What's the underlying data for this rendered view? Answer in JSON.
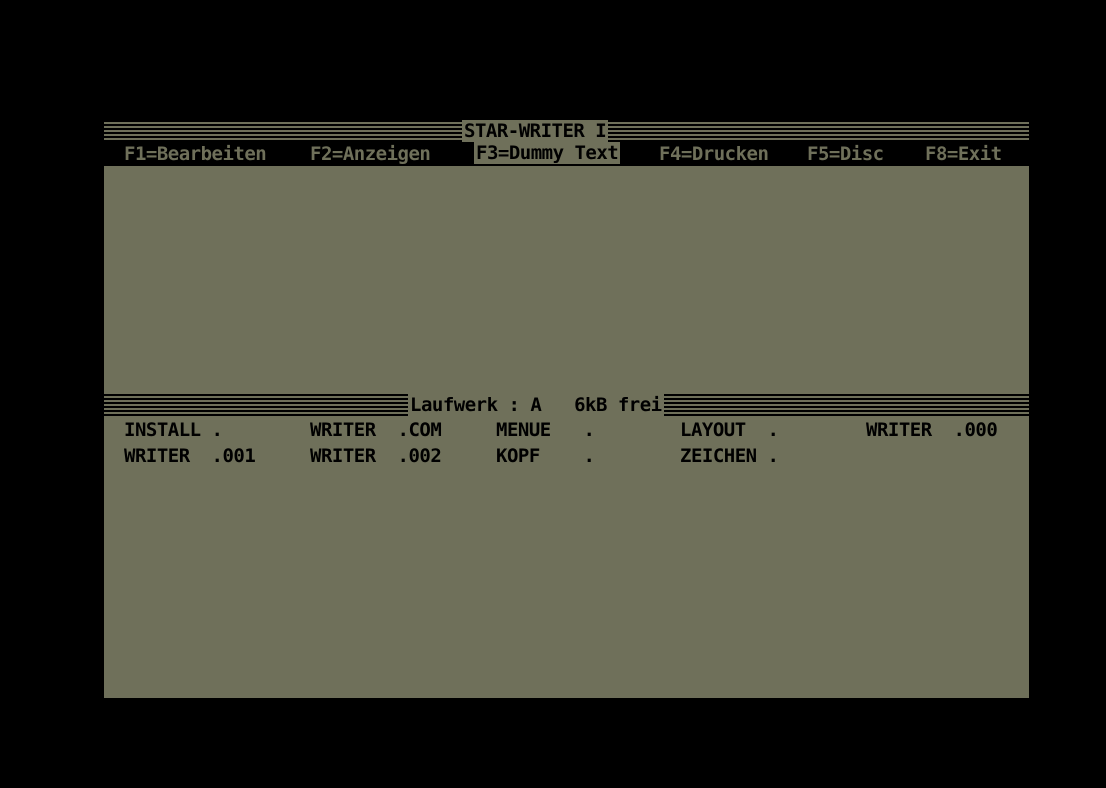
{
  "app": {
    "title": "STAR-WRITER I"
  },
  "menu": [
    {
      "label": "F1=Bearbeiten"
    },
    {
      "label": "F2=Anzeigen"
    },
    {
      "label": "F3=Dummy Text"
    },
    {
      "label": "F4=Drucken"
    },
    {
      "label": "F5=Disc"
    },
    {
      "label": "F8=Exit"
    }
  ],
  "drive": {
    "status": "Laufwerk : A   6kB frei"
  },
  "files": [
    {
      "name": "INSTALL .",
      "row": 0,
      "col": 0
    },
    {
      "name": "WRITER  .COM",
      "row": 0,
      "col": 1
    },
    {
      "name": "MENUE   .",
      "row": 0,
      "col": 2
    },
    {
      "name": "LAYOUT  .",
      "row": 0,
      "col": 3
    },
    {
      "name": "WRITER  .000",
      "row": 0,
      "col": 4
    },
    {
      "name": "WRITER  .001",
      "row": 1,
      "col": 0
    },
    {
      "name": "WRITER  .002",
      "row": 1,
      "col": 1
    },
    {
      "name": "KOPF    .",
      "row": 1,
      "col": 2
    },
    {
      "name": "ZEICHEN .",
      "row": 1,
      "col": 3
    }
  ],
  "colors": {
    "screen_bg": "#6f705a",
    "border": "#000000",
    "text": "#000000"
  }
}
